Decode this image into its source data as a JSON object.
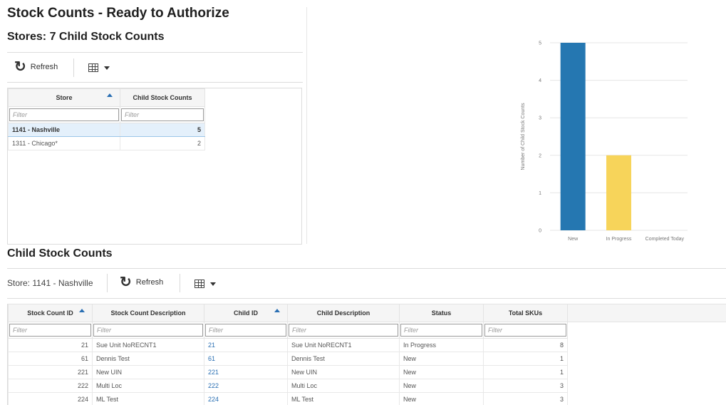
{
  "page": {
    "title": "Stock Counts - Ready to Authorize"
  },
  "stores": {
    "subtitle": "Stores: 7 Child Stock Counts",
    "toolbar": {
      "refresh_label": "Refresh",
      "refresh_icon": "refresh-icon",
      "view_icon": "table-view-icon"
    },
    "columns": [
      "Store",
      "Child Stock Counts"
    ],
    "filter_placeholder": "Filter",
    "rows": [
      {
        "store": "1141 - Nashville",
        "count": "5",
        "selected": true
      },
      {
        "store": "1311 - Chicago*",
        "count": "2",
        "selected": false
      }
    ]
  },
  "chart_data": {
    "type": "bar",
    "categories": [
      "New",
      "In Progress",
      "Completed Today"
    ],
    "values": [
      5,
      2,
      0
    ],
    "ylabel": "Number of Child Stock Counts",
    "ylim": [
      0,
      5
    ],
    "yticks": [
      "0",
      "1",
      "2",
      "3",
      "4",
      "5"
    ],
    "colors": [
      "#2577b1",
      "#f7d45a",
      "#9e9e9e"
    ],
    "grid": true
  },
  "child": {
    "title": "Child Stock Counts",
    "store_label": "Store: 1141 - Nashville",
    "toolbar": {
      "refresh_label": "Refresh"
    },
    "columns": [
      "Stock Count ID",
      "Stock Count Description",
      "Child ID",
      "Child Description",
      "Status",
      "Total SKUs"
    ],
    "filter_placeholder": "Filter",
    "rows": [
      {
        "stock_count_id": "21",
        "desc": "Sue Unit NoRECNT1",
        "child_id": "21",
        "child_desc": "Sue Unit NoRECNT1",
        "status": "In Progress",
        "skus": "8"
      },
      {
        "stock_count_id": "61",
        "desc": "Dennis Test",
        "child_id": "61",
        "child_desc": "Dennis Test",
        "status": "New",
        "skus": "1"
      },
      {
        "stock_count_id": "221",
        "desc": "New UIN",
        "child_id": "221",
        "child_desc": "New UIN",
        "status": "New",
        "skus": "1"
      },
      {
        "stock_count_id": "222",
        "desc": "Multi Loc",
        "child_id": "222",
        "child_desc": "Multi Loc",
        "status": "New",
        "skus": "3"
      },
      {
        "stock_count_id": "224",
        "desc": "ML Test",
        "child_id": "224",
        "child_desc": "ML Test",
        "status": "New",
        "skus": "3"
      }
    ]
  }
}
